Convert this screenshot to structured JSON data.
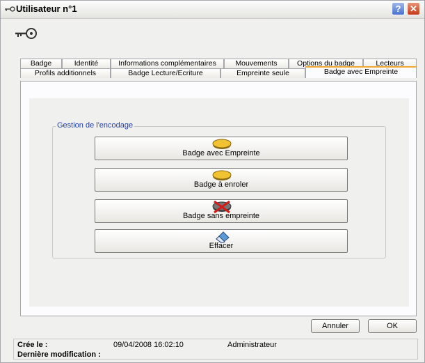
{
  "window": {
    "title": "Utilisateur n°1"
  },
  "tabs_row1": [
    "Badge",
    "Identité",
    "Informations complémentaires",
    "Mouvements",
    "Options du badge",
    "Lecteurs"
  ],
  "tabs_row2": [
    "Profils additionnels",
    "Badge Lecture/Ecriture",
    "Empreinte seule",
    "Badge avec Empreinte"
  ],
  "group": {
    "label": "Gestion de l'encodage"
  },
  "buttons": [
    {
      "label": "Badge avec Empreinte",
      "icon": "badge-icon"
    },
    {
      "label": "Badge à enroler",
      "icon": "badge-icon"
    },
    {
      "label": "Badge sans empreinte",
      "icon": "badge-crossed-icon"
    },
    {
      "label": "Effacer",
      "icon": "eraser-icon"
    }
  ],
  "actions": {
    "cancel": "Annuler",
    "ok": "OK"
  },
  "status": {
    "created_label": "Crée le :",
    "created_value": "09/04/2008 16:02:10",
    "created_by": "Administrateur",
    "modified_label": "Dernière modification :"
  },
  "colors": {
    "accent_tab": "#f2a733",
    "group_label": "#1f3fb3",
    "badge_yellow": "#f1c232"
  }
}
